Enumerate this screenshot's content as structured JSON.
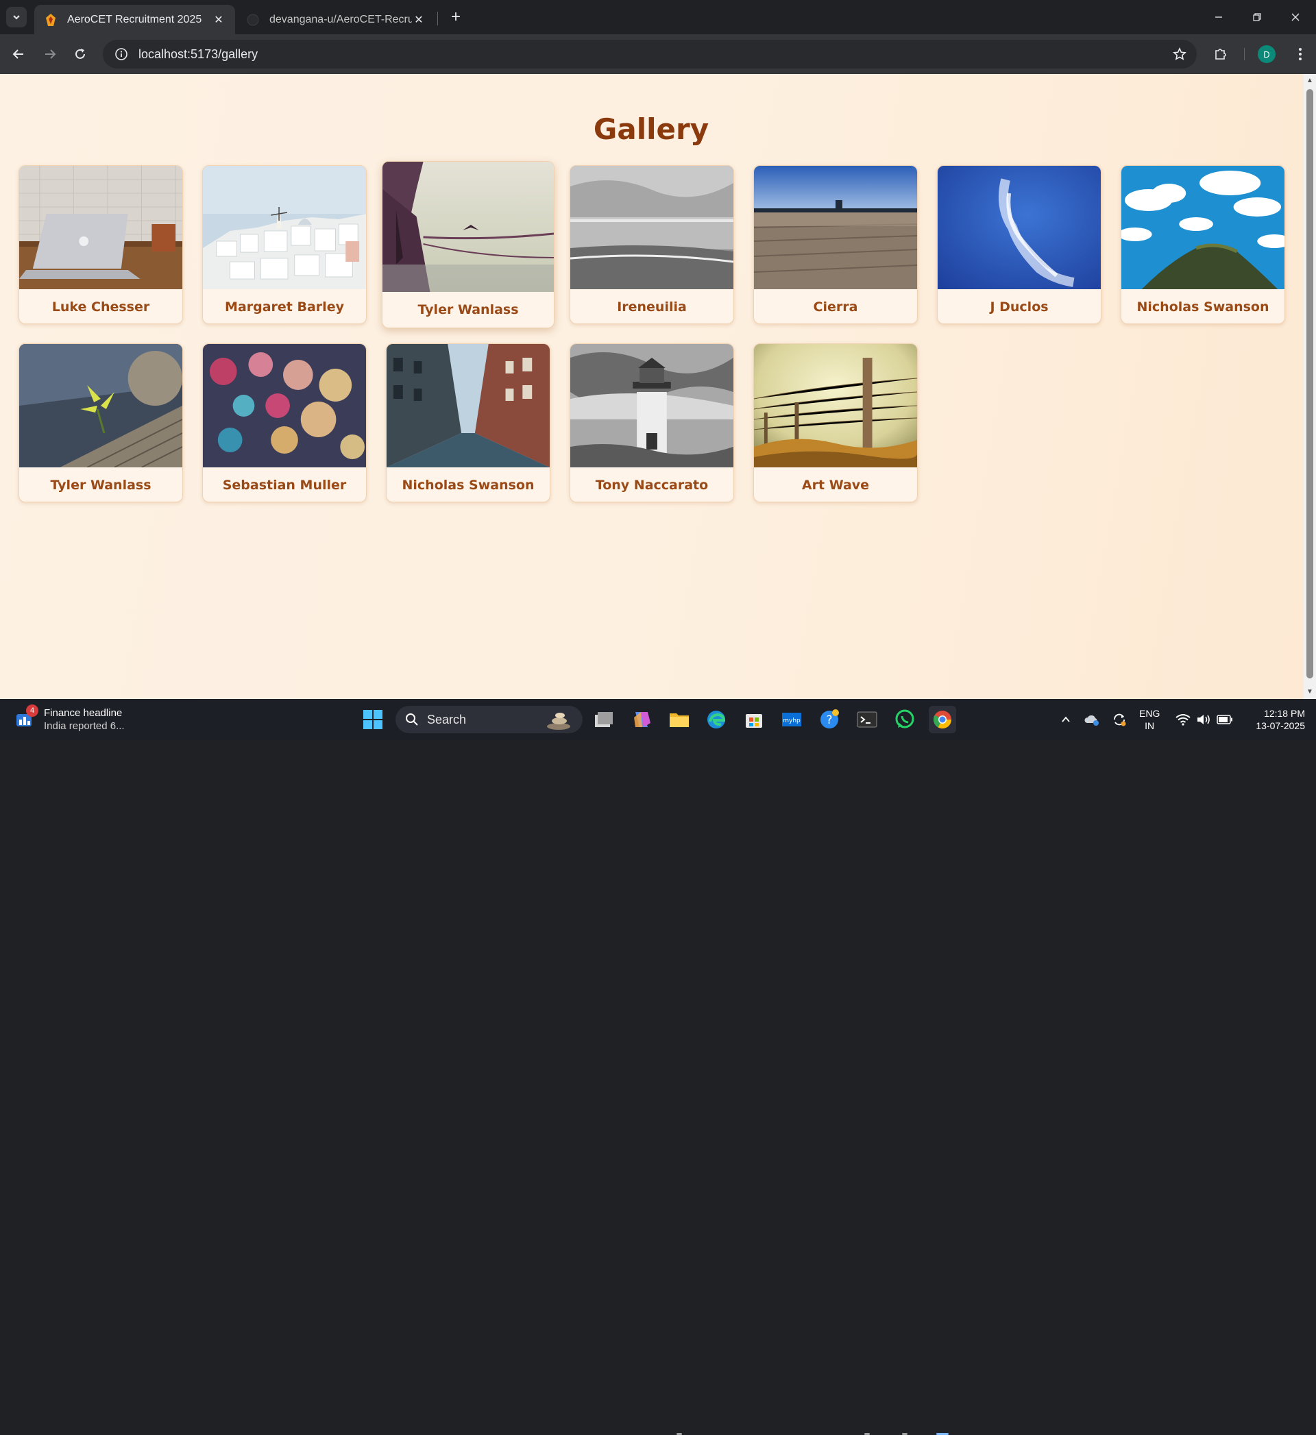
{
  "browser": {
    "tabs": [
      {
        "title": "AeroCET Recruitment 2025",
        "active": true
      },
      {
        "title": "devangana-u/AeroCET-Recruitm",
        "active": false
      }
    ],
    "url": "localhost:5173/gallery",
    "profile_initial": "D"
  },
  "page": {
    "title": "Gallery",
    "cards": [
      {
        "caption": "Luke Chesser",
        "scene": "laptop"
      },
      {
        "caption": "Margaret Barley",
        "scene": "santorini"
      },
      {
        "caption": "Tyler Wanlass",
        "scene": "boat"
      },
      {
        "caption": "Ireneuilia",
        "scene": "beach-bw"
      },
      {
        "caption": "Cierra",
        "scene": "pier"
      },
      {
        "caption": "J Duclos",
        "scene": "sky-cloud"
      },
      {
        "caption": "Nicholas Swanson",
        "scene": "clouds-hill"
      },
      {
        "caption": "Tyler Wanlass",
        "scene": "flower-wood"
      },
      {
        "caption": "Sebastian Muller",
        "scene": "bokeh"
      },
      {
        "caption": "Nicholas Swanson",
        "scene": "street"
      },
      {
        "caption": "Tony Naccarato",
        "scene": "lighthouse"
      },
      {
        "caption": "Art Wave",
        "scene": "fence"
      }
    ]
  },
  "taskbar": {
    "widget_title": "Finance headline",
    "widget_subtitle": "India reported 6...",
    "widget_badge": "4",
    "search_placeholder": "Search",
    "lang_line1": "ENG",
    "lang_line2": "IN",
    "time": "12:18 PM",
    "date": "13-07-2025"
  },
  "colors": {
    "title": "#8b3a0e",
    "caption": "#9a4a16",
    "card_bg": "#fff4ea",
    "page_bg": "#fdf0e0"
  }
}
